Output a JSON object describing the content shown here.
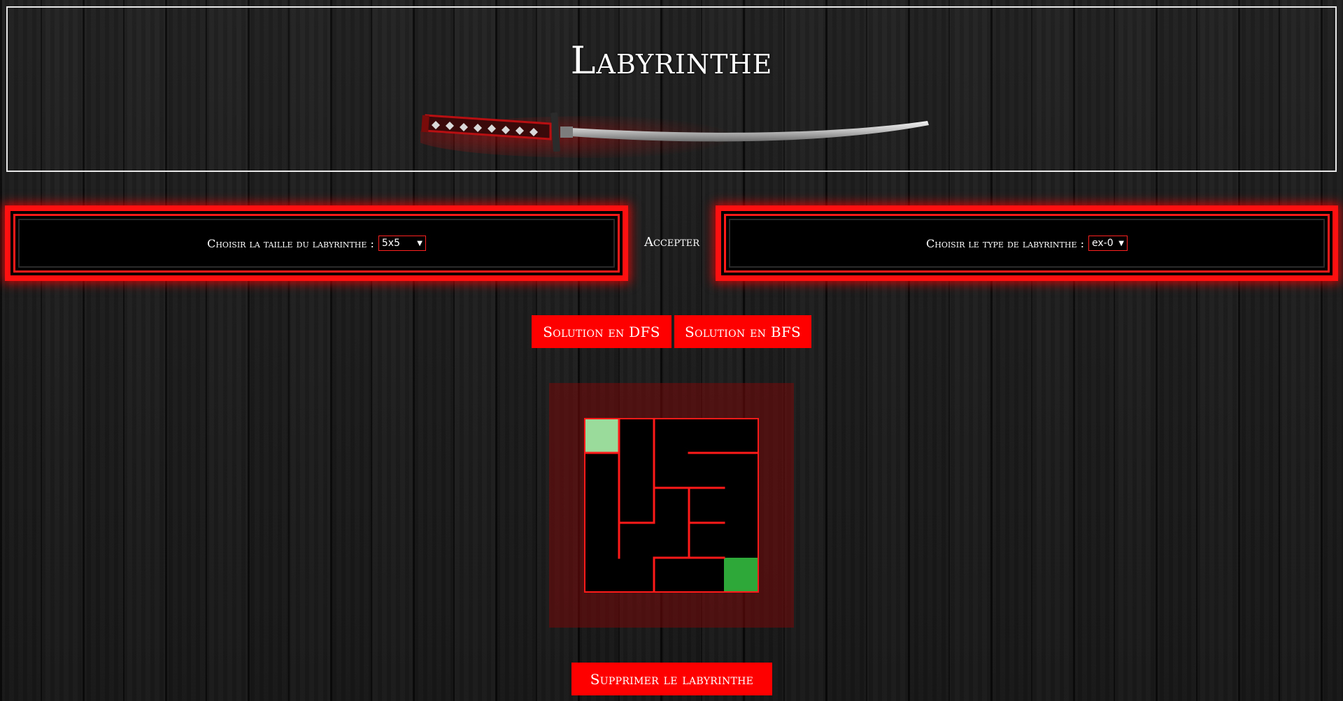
{
  "header": {
    "title": "Labyrinthe",
    "image": "katana-sword-image"
  },
  "controls": {
    "size_label": "Choisir la taille du labyrinthe :",
    "size_value": "5x5",
    "accept_label": "Accepter",
    "type_label": "Choisir le type de labyrinthe :",
    "type_value": "ex-0"
  },
  "actions": {
    "dfs_label": "Solution en DFS",
    "bfs_label": "Solution en BFS",
    "delete_label": "Supprimer le labyrinthe"
  },
  "maze": {
    "rows": 5,
    "cols": 5,
    "start": [
      0,
      0
    ],
    "end": [
      4,
      4
    ],
    "walls": [
      {
        "cell": [
          0,
          0
        ],
        "sides": [
          "right",
          "bottom"
        ]
      },
      {
        "cell": [
          0,
          1
        ],
        "sides": [
          "right"
        ]
      },
      {
        "cell": [
          0,
          3
        ],
        "sides": [
          "bottom"
        ]
      },
      {
        "cell": [
          0,
          4
        ],
        "sides": [
          "bottom"
        ]
      },
      {
        "cell": [
          1,
          0
        ],
        "sides": [
          "right"
        ]
      },
      {
        "cell": [
          1,
          1
        ],
        "sides": [
          "right"
        ]
      },
      {
        "cell": [
          1,
          2
        ],
        "sides": [
          "bottom"
        ]
      },
      {
        "cell": [
          1,
          3
        ],
        "sides": [
          "bottom"
        ]
      },
      {
        "cell": [
          2,
          0
        ],
        "sides": [
          "right"
        ]
      },
      {
        "cell": [
          2,
          1
        ],
        "sides": [
          "bottom"
        ]
      },
      {
        "cell": [
          2,
          3
        ],
        "sides": [
          "left",
          "bottom"
        ]
      },
      {
        "cell": [
          2,
          2
        ],
        "sides": [
          "left"
        ]
      },
      {
        "cell": [
          3,
          0
        ],
        "sides": [
          "right"
        ]
      },
      {
        "cell": [
          3,
          2
        ],
        "sides": [
          "right",
          "bottom"
        ]
      },
      {
        "cell": [
          3,
          3
        ],
        "sides": [
          "bottom"
        ]
      },
      {
        "cell": [
          4,
          1
        ],
        "sides": [
          "right"
        ]
      }
    ],
    "colors": {
      "wall": "#ff1a1a",
      "cell": "#000000",
      "start": "#9adb9c",
      "end": "#2fa83a",
      "frame": "#7a0a0a"
    }
  },
  "colors": {
    "accent": "#ff0000",
    "panel_border": "#ff1010"
  }
}
